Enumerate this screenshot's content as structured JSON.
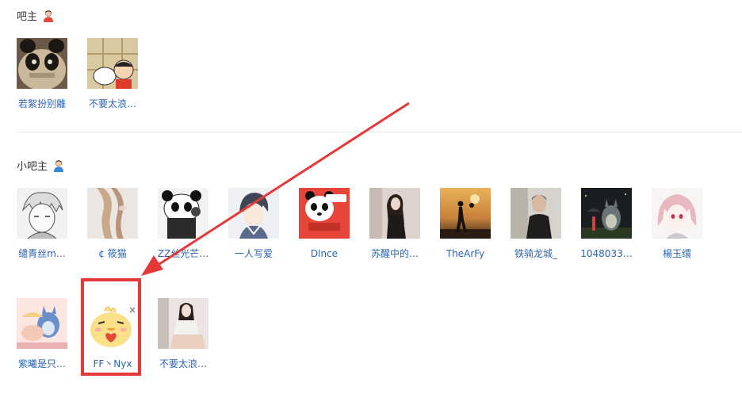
{
  "sections": {
    "owner": {
      "title": "吧主",
      "icon": "user-red-icon"
    },
    "deputy": {
      "title": "小吧主",
      "icon": "user-blue-icon"
    }
  },
  "owners": [
    {
      "name": "若絮扮别離",
      "avatar": "panda-face-avatar"
    },
    {
      "name": "不要太浪…",
      "avatar": "cartoon-kid-avatar"
    }
  ],
  "deputies": [
    {
      "name": "缱青丝m…",
      "avatar": "anime-sketch-avatar"
    },
    {
      "name": "¢ 筱猫",
      "avatar": "braid-hair-avatar"
    },
    {
      "name": "ZZ丝光芒…",
      "avatar": "panda-hat-avatar"
    },
    {
      "name": "一人写爱",
      "avatar": "anime-boy-avatar"
    },
    {
      "name": "Dlnce",
      "avatar": "panda-red-avatar"
    },
    {
      "name": "苏醒中的…",
      "avatar": "girl-portrait-avatar"
    },
    {
      "name": "TheArFy",
      "avatar": "sunset-silhouette-avatar"
    },
    {
      "name": "铁骑龙城_",
      "avatar": "man-dark-avatar"
    },
    {
      "name": "1048033…",
      "avatar": "totoro-night-avatar"
    },
    {
      "name": "楊玉缳",
      "avatar": "pink-hair-avatar"
    },
    {
      "name": "紫曦是只…",
      "avatar": "cute-cartoon-avatar"
    },
    {
      "name": "FF丶Nyx",
      "avatar": "chick-heart-avatar"
    },
    {
      "name": "不要太浪…",
      "avatar": "girl-sitting-avatar"
    }
  ],
  "annotation": {
    "highlight_color": "#e53838",
    "highlighted_member": "FF丶Nyx"
  }
}
